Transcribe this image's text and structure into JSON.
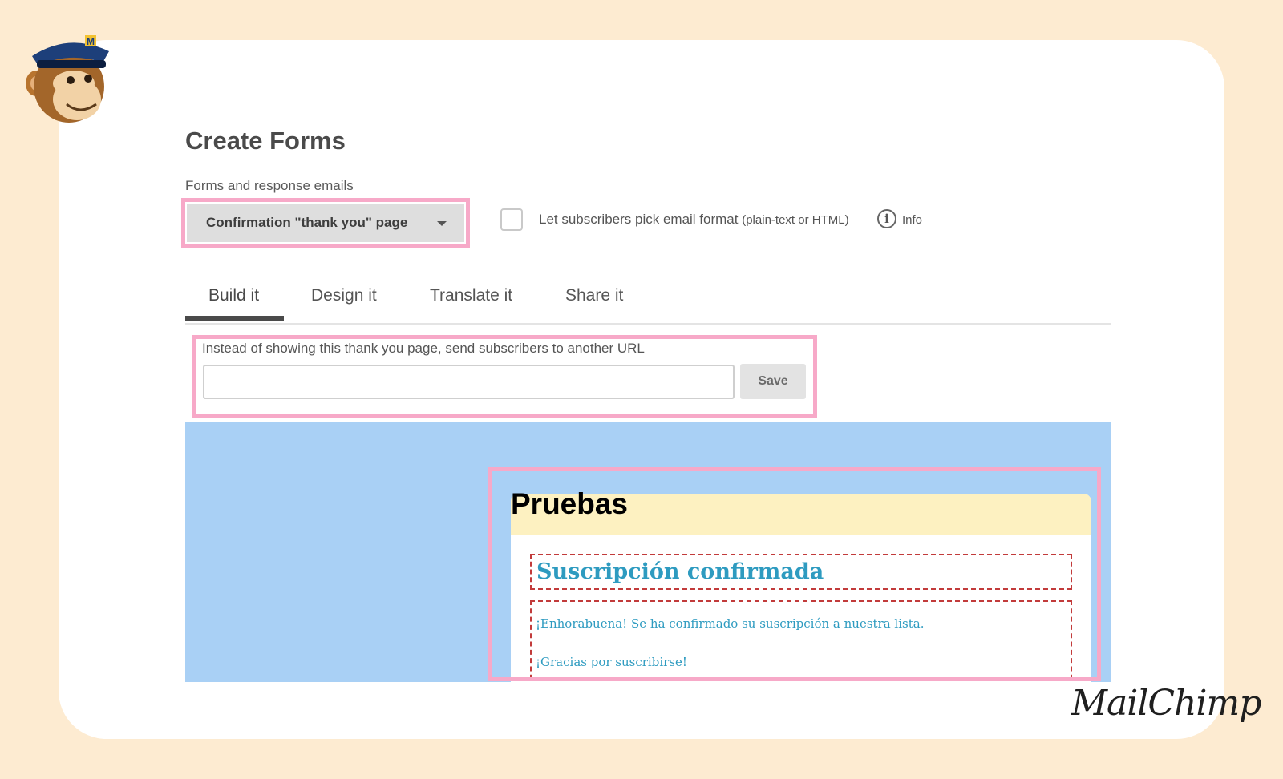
{
  "page": {
    "title": "Create Forms",
    "forms_label": "Forms and response emails"
  },
  "form_selector": {
    "selected": "Confirmation \"thank you\" page"
  },
  "email_format": {
    "label": "Let subscribers pick email format",
    "label_note": "(plain-text or HTML)",
    "checked": false,
    "info_label": "Info"
  },
  "tabs": [
    {
      "label": "Build it",
      "active": true
    },
    {
      "label": "Design it"
    },
    {
      "label": "Translate it"
    },
    {
      "label": "Share it"
    }
  ],
  "redirect": {
    "label": "Instead of showing this thank you page, send subscribers to another URL",
    "value": "",
    "save_label": "Save"
  },
  "preview": {
    "form_title": "Pruebas",
    "heading": "Suscripción confirmada",
    "line1": "¡Enhorabuena! Se ha confirmado su suscripción a nuestra lista.",
    "line2": "¡Gracias por suscribirse!"
  },
  "brand": {
    "name": "MailChimp",
    "mascot_badge": "M"
  },
  "colors": {
    "background": "#fdebd1",
    "highlight": "#f7a9c8",
    "preview_bg": "#a9d0f5",
    "header_bg": "#fdf1c1",
    "accent": "#2e9bc0"
  }
}
